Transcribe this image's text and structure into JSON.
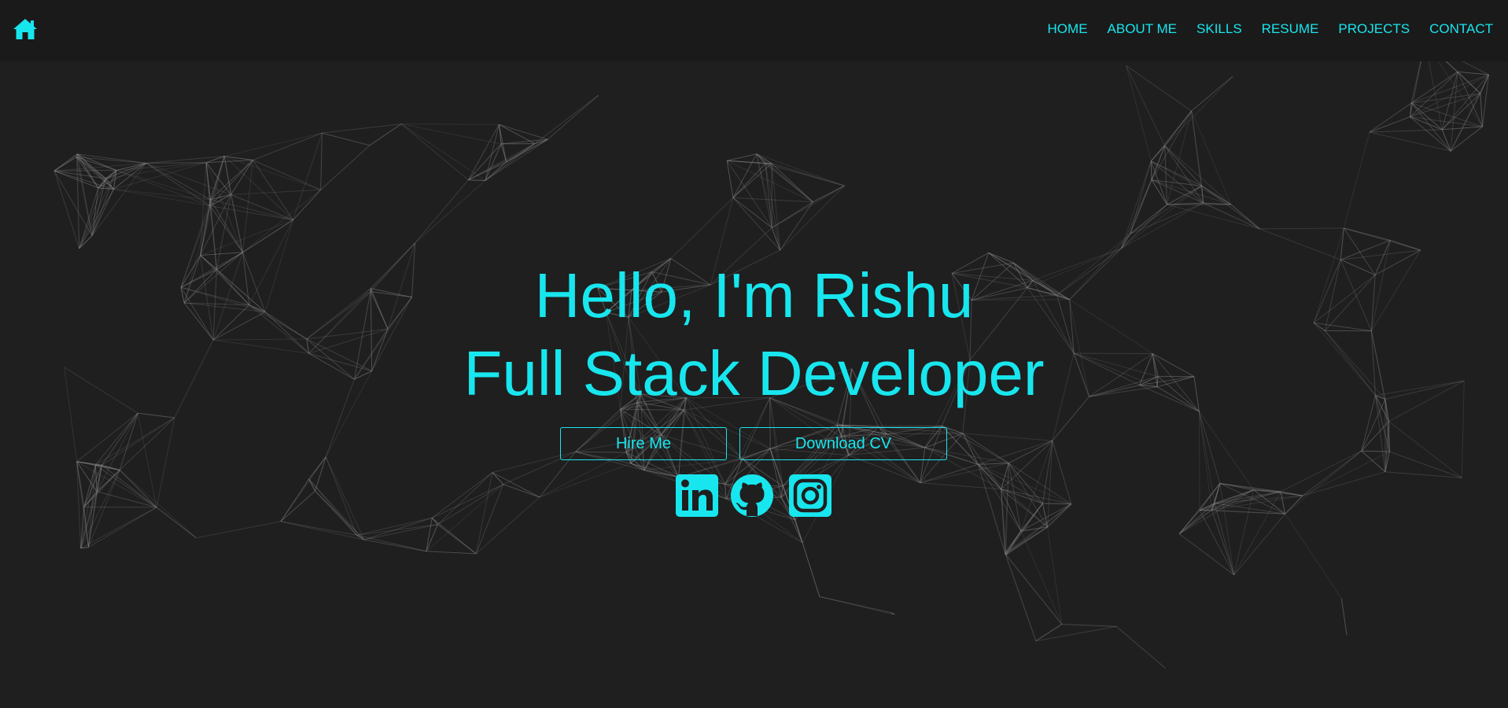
{
  "colors": {
    "accent": "#18e6ee",
    "background": "#1f1f1f",
    "navbar": "#1a1a1a",
    "network_lines": "#8a8a8a"
  },
  "nav": {
    "logo_icon": "home-icon",
    "links": [
      {
        "label": "HOME"
      },
      {
        "label": "ABOUT ME"
      },
      {
        "label": "SKILLS"
      },
      {
        "label": "RESUME"
      },
      {
        "label": "PROJECTS"
      },
      {
        "label": "CONTACT"
      }
    ]
  },
  "hero": {
    "greeting": "Hello, I'm Rishu",
    "role": "Full Stack Developer",
    "buttons": {
      "hire": "Hire Me",
      "cv": "Download CV"
    },
    "social_icons": [
      "linkedin-icon",
      "github-icon",
      "instagram-icon"
    ]
  }
}
